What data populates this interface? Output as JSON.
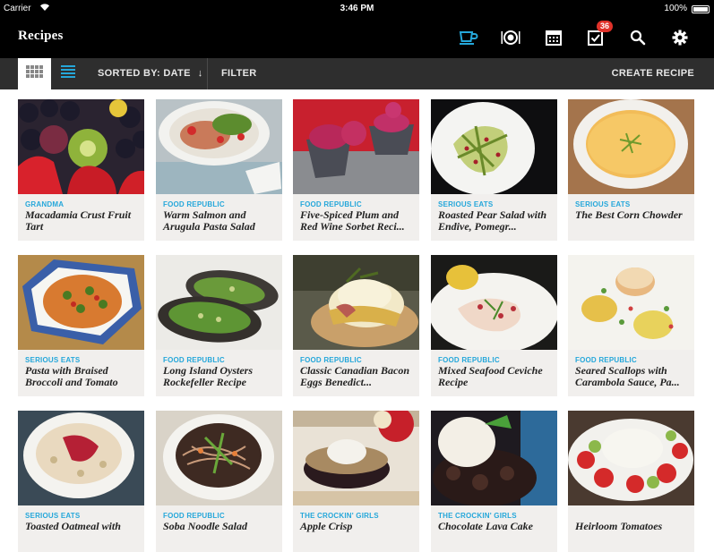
{
  "status": {
    "carrier": "Carrier",
    "time": "3:46 PM",
    "battery": "100%"
  },
  "nav": {
    "title": "Recipes",
    "icons": [
      "cup-icon",
      "plate-icon",
      "calendar-icon",
      "checklist-icon",
      "search-icon",
      "gear-icon"
    ],
    "badge": "36",
    "accent": "#25a7da"
  },
  "toolbar": {
    "sort_label": "SORTED BY: DATE",
    "sort_arrow": "↓",
    "filter_label": "FILTER",
    "create_label": "CREATE RECIPE"
  },
  "recipes": [
    {
      "source": "GRANDMA",
      "name": "Macadamia Crust Fruit Tart"
    },
    {
      "source": "FOOD REPUBLIC",
      "name": "Warm Salmon and Arugula Pasta Salad"
    },
    {
      "source": "FOOD REPUBLIC",
      "name": "Five-Spiced Plum and Red Wine Sorbet Reci..."
    },
    {
      "source": "SERIOUS EATS",
      "name": "Roasted Pear Salad with Endive, Pomegr..."
    },
    {
      "source": "SERIOUS EATS",
      "name": "The Best Corn Chowder"
    },
    {
      "source": "SERIOUS EATS",
      "name": "Pasta with Braised Broccoli and Tomato"
    },
    {
      "source": "FOOD REPUBLIC",
      "name": "Long Island Oysters Rockefeller Recipe"
    },
    {
      "source": "FOOD REPUBLIC",
      "name": "Classic Canadian Bacon Eggs Benedict..."
    },
    {
      "source": "FOOD REPUBLIC",
      "name": "Mixed Seafood Ceviche Recipe"
    },
    {
      "source": "FOOD REPUBLIC",
      "name": "Seared Scallops with Carambola Sauce, Pa..."
    },
    {
      "source": "SERIOUS EATS",
      "name": "Toasted Oatmeal with"
    },
    {
      "source": "FOOD REPUBLIC",
      "name": "Soba Noodle Salad"
    },
    {
      "source": "THE CROCKIN' GIRLS",
      "name": "Apple Crisp"
    },
    {
      "source": "THE CROCKIN' GIRLS",
      "name": "Chocolate Lava Cake"
    },
    {
      "source": "",
      "name": "Heirloom Tomatoes"
    }
  ]
}
